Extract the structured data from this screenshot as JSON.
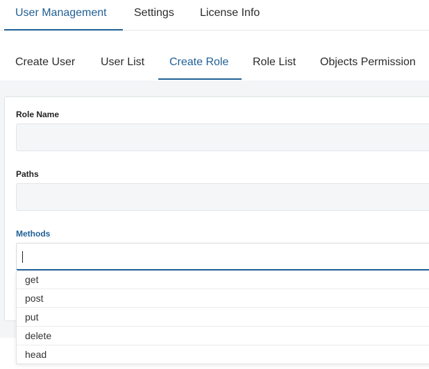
{
  "top_tabs": [
    {
      "label": "User Management",
      "active": true
    },
    {
      "label": "Settings",
      "active": false
    },
    {
      "label": "License Info",
      "active": false
    }
  ],
  "sub_tabs": [
    {
      "label": "Create User",
      "active": false
    },
    {
      "label": "User List",
      "active": false
    },
    {
      "label": "Create Role",
      "active": true
    },
    {
      "label": "Role List",
      "active": false
    },
    {
      "label": "Objects Permission",
      "active": false
    }
  ],
  "form": {
    "role_name": {
      "label": "Role Name",
      "value": ""
    },
    "paths": {
      "label": "Paths",
      "value": ""
    },
    "methods": {
      "label": "Methods",
      "value": ""
    }
  },
  "methods_dropdown": {
    "options": [
      "get",
      "post",
      "put",
      "delete",
      "head"
    ]
  },
  "colors": {
    "accent": "#1f5f96",
    "input_bg": "#f5f6f8",
    "border": "#e2e4e8"
  }
}
